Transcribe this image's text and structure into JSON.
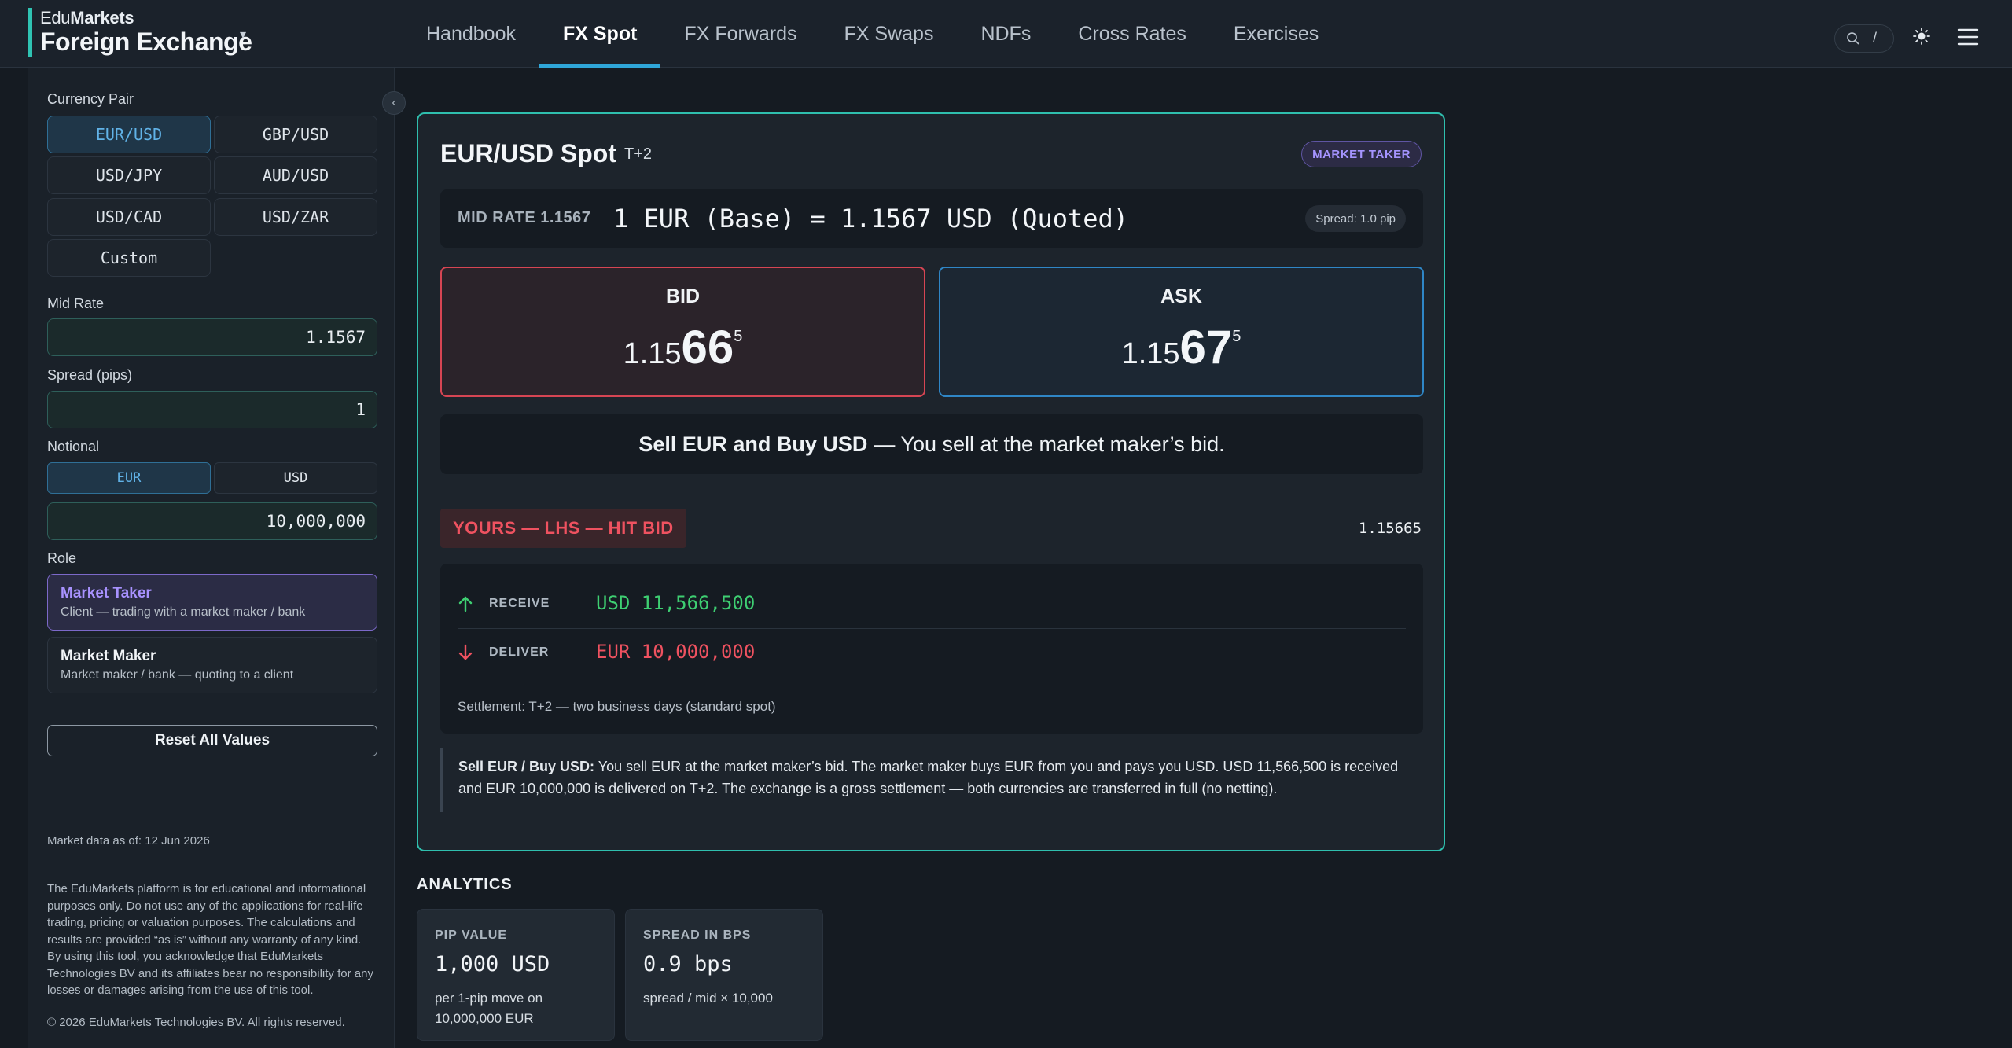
{
  "brand": {
    "top_prefix": "Edu",
    "top_bold": "Markets",
    "main": "Foreign Exchange",
    "caret": "▾"
  },
  "nav": {
    "items": [
      "Handbook",
      "FX Spot",
      "FX Forwards",
      "FX Swaps",
      "NDFs",
      "Cross Rates",
      "Exercises"
    ],
    "active": "FX Spot"
  },
  "search": {
    "shortcut": "/"
  },
  "sidebar": {
    "pair_label": "Currency Pair",
    "pairs": [
      "EUR/USD",
      "GBP/USD",
      "USD/JPY",
      "AUD/USD",
      "USD/CAD",
      "USD/ZAR",
      "Custom"
    ],
    "selected_pair": "EUR/USD",
    "mid_label": "Mid Rate",
    "mid_value": "1.1567",
    "spread_label": "Spread (pips)",
    "spread_value": "1",
    "notional_label": "Notional",
    "notional_ccy": [
      "EUR",
      "USD"
    ],
    "notional_selected": "EUR",
    "notional_value": "10,000,000",
    "role_label": "Role",
    "roles": [
      {
        "title": "Market Taker",
        "sub": "Client — trading with a market maker / bank"
      },
      {
        "title": "Market Maker",
        "sub": "Market maker / bank — quoting to a client"
      }
    ],
    "selected_role": "Market Taker",
    "reset_label": "Reset All Values",
    "market_data": "Market data as of: 12 Jun 2026",
    "disclaimer": [
      "The EduMarkets platform is for educational and informational",
      "purposes only. Do not use any of the applications for real-life",
      "trading, pricing or valuation purposes. The calculations and",
      "results are provided “as is” without any warranty of any kind.",
      "By using this tool, you acknowledge that EduMarkets",
      "Technologies BV and its affiliates bear no responsibility for any",
      "losses or damages arising from the use of this tool."
    ],
    "copyright": "© 2026 EduMarkets Technologies BV. All rights reserved.",
    "collapse_glyph": "‹"
  },
  "card": {
    "title": "EUR/USD Spot",
    "tag": "T+2",
    "badge": "MARKET TAKER",
    "rate_label": "MID RATE 1.1567",
    "rate_equation": "1 EUR (Base) = 1.1567 USD (Quoted)",
    "spread_pill": "Spread: 1.0 pip",
    "bid": {
      "label": "BID",
      "small": "1.15",
      "big": "66",
      "sup": "5"
    },
    "ask": {
      "label": "ASK",
      "small": "1.15",
      "big": "67",
      "sup": "5"
    },
    "action_bold": "Sell EUR and Buy USD",
    "action_rest": "— You sell at the market maker’s bid.",
    "yours_badge": "YOURS — LHS — HIT BID",
    "yours_rate": "1.15665",
    "receive_label": "RECEIVE",
    "receive_value": "USD 11,566,500",
    "deliver_label": "DELIVER",
    "deliver_value": "EUR 10,000,000",
    "settlement": "Settlement: T+2 — two business days (standard spot)",
    "expl_bold": "Sell EUR / Buy USD:",
    "expl_line1": "You sell EUR at the market maker’s bid. The market maker buys EUR from you and pays you USD. USD 11,566,500 is received",
    "expl_line2": "and EUR 10,000,000 is delivered on T+2. The exchange is a gross settlement — both currencies are transferred in full (no netting)."
  },
  "analytics": {
    "title": "ANALYTICS",
    "cards": [
      {
        "label": "PIP VALUE",
        "value": "1,000 USD",
        "sub": "per 1-pip move on 10,000,000 EUR"
      },
      {
        "label": "SPREAD IN BPS",
        "value": "0.9 bps",
        "sub": "spread / mid × 10,000"
      }
    ]
  },
  "colors": {
    "accent": "#2fbfae",
    "nav_active": "#2fa6d8",
    "bid": "#d64553",
    "ask": "#2f86c6",
    "receive": "#3ecf72",
    "deliver": "#ef5260",
    "taker": "#a594ff"
  },
  "icons": [
    "search-icon",
    "sun-icon",
    "menu-icon",
    "arrow-up-icon",
    "arrow-down-icon",
    "chevron-left-icon",
    "chevron-down-icon"
  ]
}
